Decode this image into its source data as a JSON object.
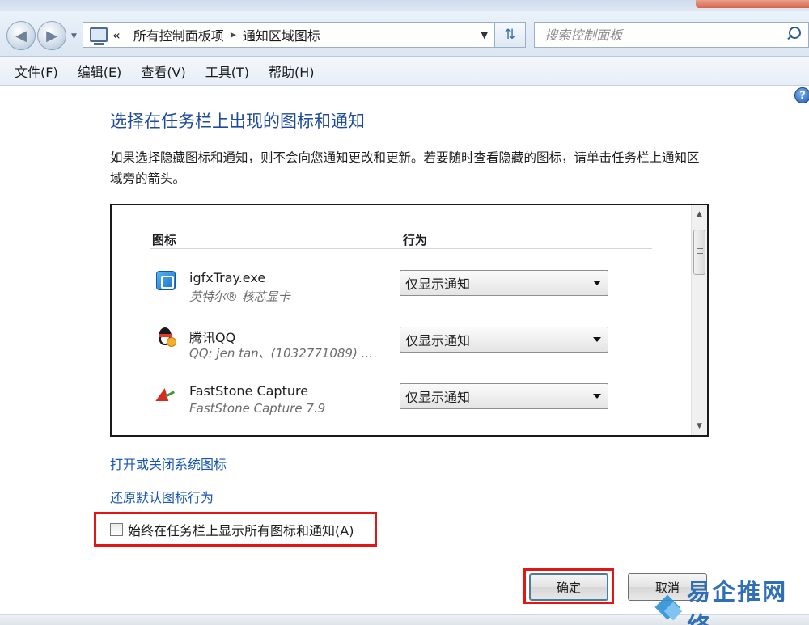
{
  "window": {
    "breadcrumb": {
      "prefix": "«",
      "items": [
        "所有控制面板项",
        "通知区域图标"
      ],
      "separator": "▸"
    },
    "search": {
      "placeholder": "搜索控制面板"
    }
  },
  "menu": [
    "文件(F)",
    "编辑(E)",
    "查看(V)",
    "工具(T)",
    "帮助(H)"
  ],
  "content": {
    "title": "选择在任务栏上出现的图标和通知",
    "description": "如果选择隐藏图标和通知，则不会向您通知更改和更新。若要随时查看隐藏的图标，请单击任务栏上通知区域旁的箭头。",
    "columns": {
      "icon": "图标",
      "behavior": "行为"
    },
    "rows": [
      {
        "icon": "igfx-icon",
        "name": "igfxTray.exe",
        "description": "英特尔® 核芯显卡",
        "behavior": "仅显示通知"
      },
      {
        "icon": "qq-icon",
        "name": "腾讯QQ",
        "description": "QQ: jen tan、(1032771089) ...",
        "behavior": "仅显示通知"
      },
      {
        "icon": "faststone-icon",
        "name": "FastStone Capture",
        "description": "FastStone Capture 7.9",
        "behavior": "仅显示通知"
      }
    ],
    "links": {
      "system_icons": "打开或关闭系统图标",
      "restore_default": "还原默认图标行为"
    },
    "always_show": {
      "label": "始终在任务栏上显示所有图标和通知(A)",
      "checked": false
    }
  },
  "buttons": {
    "ok": "确定",
    "cancel": "取消"
  },
  "watermark": {
    "text": "易企推网络"
  },
  "colors": {
    "title": "#1f4b9b",
    "link": "#1a57b3",
    "highlight": "#e01717"
  }
}
